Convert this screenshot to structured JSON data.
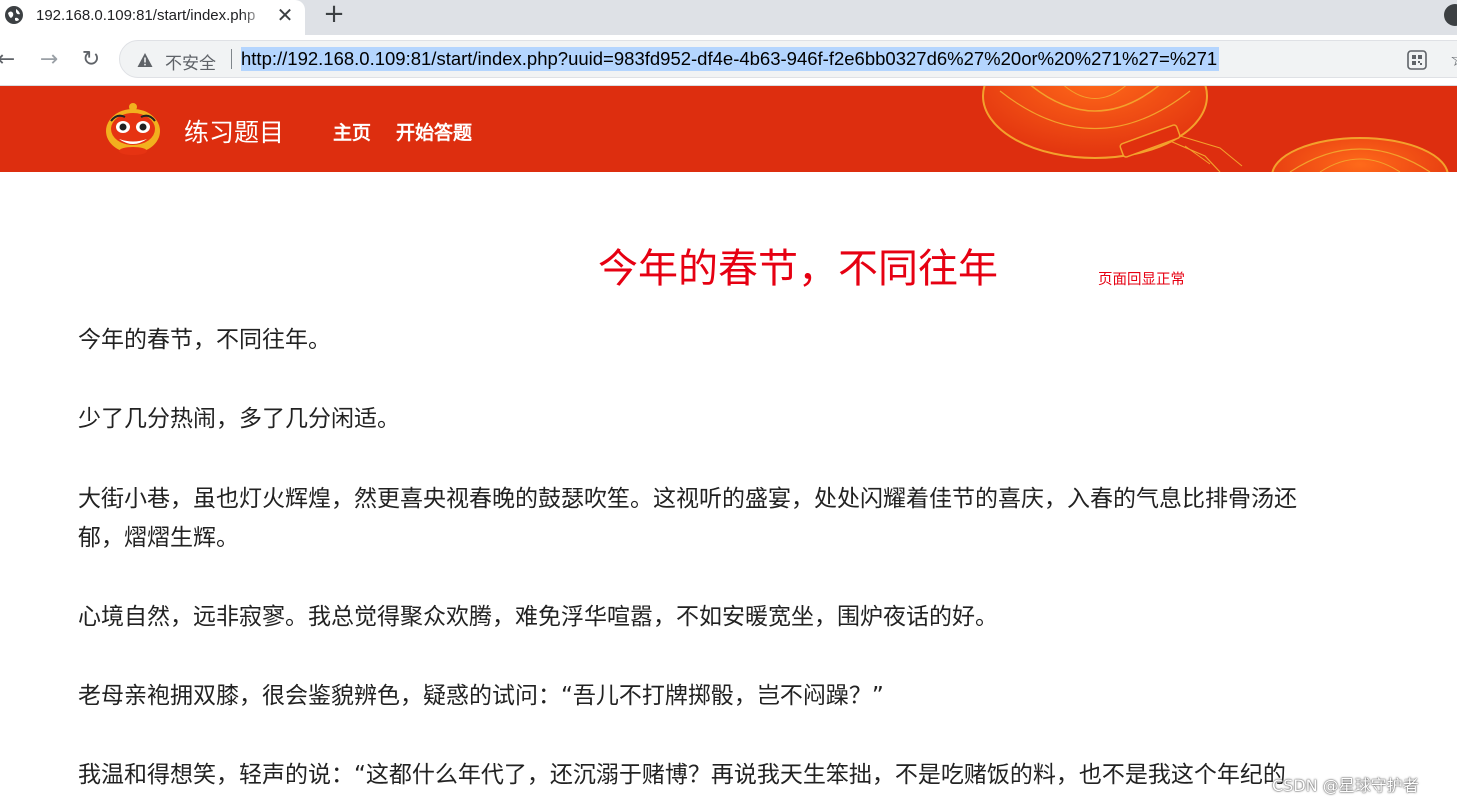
{
  "browser": {
    "tab_title": "192.168.0.109:81/start/index.php",
    "tab_close": "✕",
    "new_tab": "+",
    "security_label": "不安全",
    "url": "http://192.168.0.109:81/start/index.php?uuid=983fd952-df4e-4b63-946f-f2e6bb0327d6%27%20or%20%271%27=%271",
    "back": "←",
    "forward": "→",
    "reload": "↻"
  },
  "header": {
    "site_name": "练习题目",
    "nav": [
      {
        "label": "主页"
      },
      {
        "label": "开始答题"
      }
    ]
  },
  "article": {
    "title": "今年的春节，不同往年",
    "echo_note": "页面回显正常",
    "paragraphs": [
      "今年的春节，不同往年。",
      "少了几分热闹，多了几分闲适。",
      "大街小巷，虽也灯火辉煌，然更喜央视春晚的鼓瑟吹笙。这视听的盛宴，处处闪耀着佳节的喜庆，入春的气息比排骨汤还",
      "郁，熠熠生辉。",
      "心境自然，远非寂寥。我总觉得聚众欢腾，难免浮华喧嚣，不如安暖宽坐，围炉夜话的好。",
      "老母亲袍拥双膝，很会鉴貌辨色，疑惑的试问：“吾儿不打牌掷骰，岂不闷躁？”",
      "我温和得想笑，轻声的说：“这都什么年代了，还沉溺于赌博？再说我天生笨拙，不是吃赌饭的料，也不是我这个年纪的"
    ]
  },
  "watermark": "CSDN @星球守护者"
}
